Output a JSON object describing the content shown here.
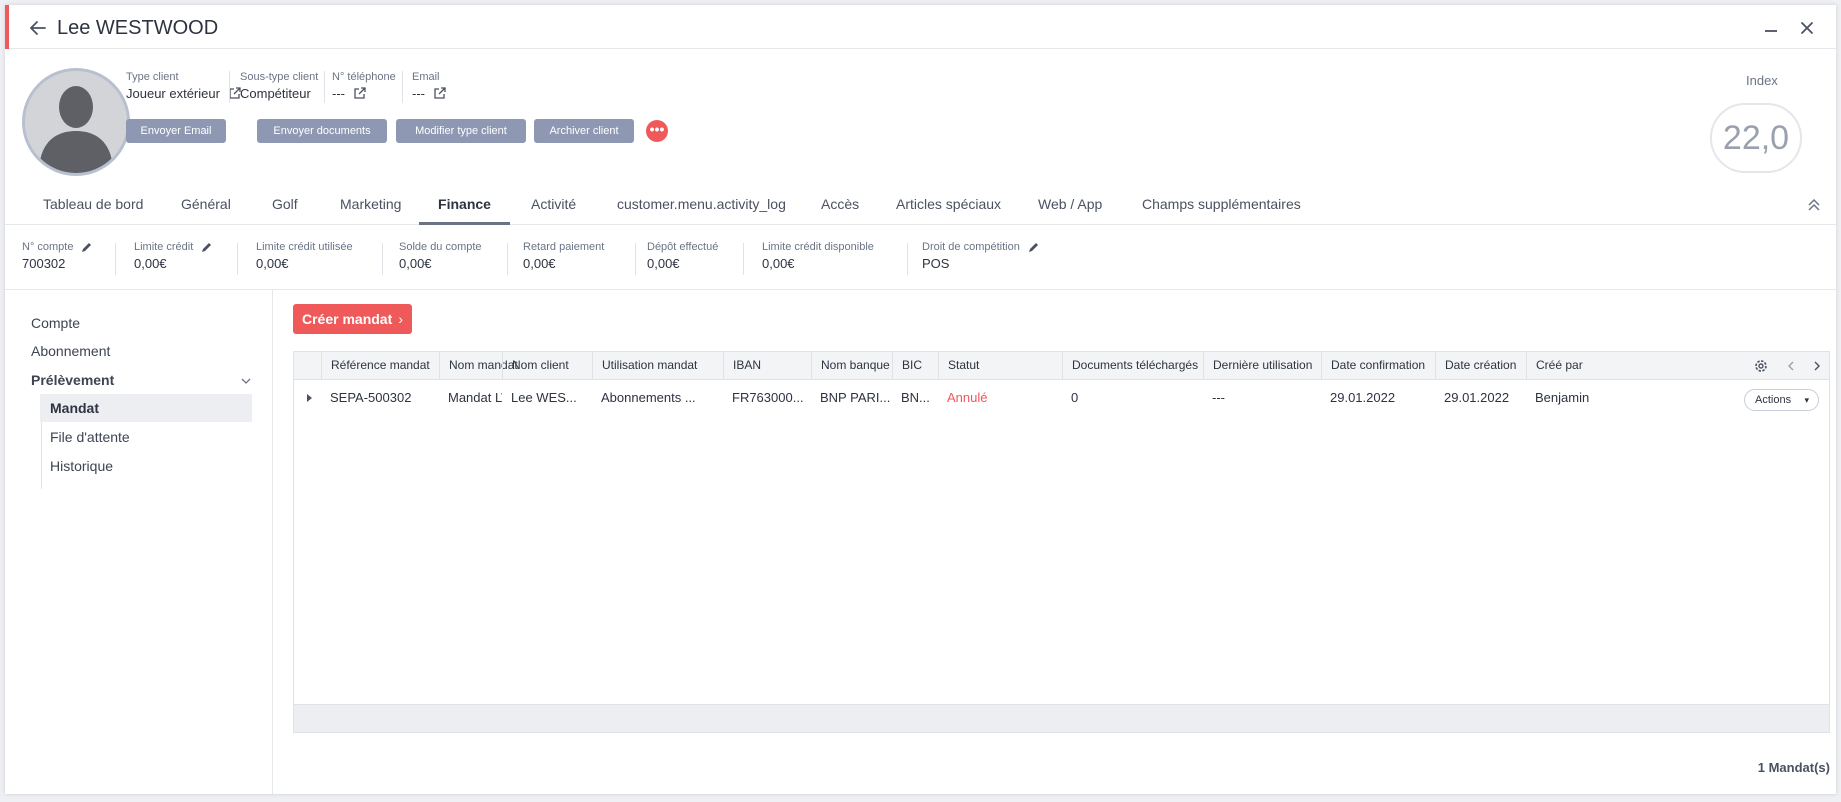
{
  "header": {
    "title": "Lee WESTWOOD"
  },
  "profile": {
    "fields": [
      {
        "label": "Type client",
        "value": "Joueur extérieur"
      },
      {
        "label": "Sous-type client",
        "value": "Compétiteur"
      },
      {
        "label": "N° téléphone",
        "value": "---"
      },
      {
        "label": "Email",
        "value": "---"
      }
    ],
    "buttons": [
      "Envoyer Email",
      "Envoyer documents",
      "Modifier type client",
      "Archiver client"
    ],
    "more_label": "•••",
    "index": {
      "label": "Index",
      "value": "22,0"
    }
  },
  "tabs": [
    "Tableau de bord",
    "Général",
    "Golf",
    "Marketing",
    "Finance",
    "Activité",
    "customer.menu.activity_log",
    "Accès",
    "Articles spéciaux",
    "Web / App",
    "Champs supplémentaires"
  ],
  "active_tab": "Finance",
  "finance": [
    {
      "label": "N° compte",
      "value": "700302",
      "editable": true
    },
    {
      "label": "Limite crédit",
      "value": "0,00€",
      "editable": true
    },
    {
      "label": "Limite crédit utilisée",
      "value": "0,00€",
      "editable": false
    },
    {
      "label": "Solde du compte",
      "value": "0,00€",
      "editable": false
    },
    {
      "label": "Retard paiement",
      "value": "0,00€",
      "editable": false
    },
    {
      "label": "Dépôt effectué",
      "value": "0,00€",
      "editable": false
    },
    {
      "label": "Limite crédit disponible",
      "value": "0,00€",
      "editable": false
    },
    {
      "label": "Droit de compétition",
      "value": "POS",
      "editable": true
    }
  ],
  "sidebar": {
    "items": [
      "Compte",
      "Abonnement",
      "Prélèvement"
    ],
    "sub_items": [
      "Mandat",
      "File d'attente",
      "Historique"
    ],
    "active_sub": "Mandat"
  },
  "main": {
    "create_button": "Créer mandat",
    "create_arrow": "›",
    "columns": [
      "Référence mandat",
      "Nom mandat",
      "Nom client",
      "Utilisation mandat",
      "IBAN",
      "Nom banque",
      "BIC",
      "Statut",
      "Documents téléchargés",
      "Dernière utilisation",
      "Date confirmation",
      "Date création",
      "Créé par"
    ],
    "rows": [
      [
        "SEPA-500302",
        "Mandat LW",
        "Lee WES...",
        "Abonnements ...",
        "FR763000...",
        "BNP PARI...",
        "BN...",
        "Annulé",
        "0",
        "---",
        "29.01.2022",
        "29.01.2022",
        "Benjamin"
      ]
    ],
    "status_color": "#f0595a",
    "actions_label": "Actions",
    "count_label": "1 Mandat(s)"
  }
}
